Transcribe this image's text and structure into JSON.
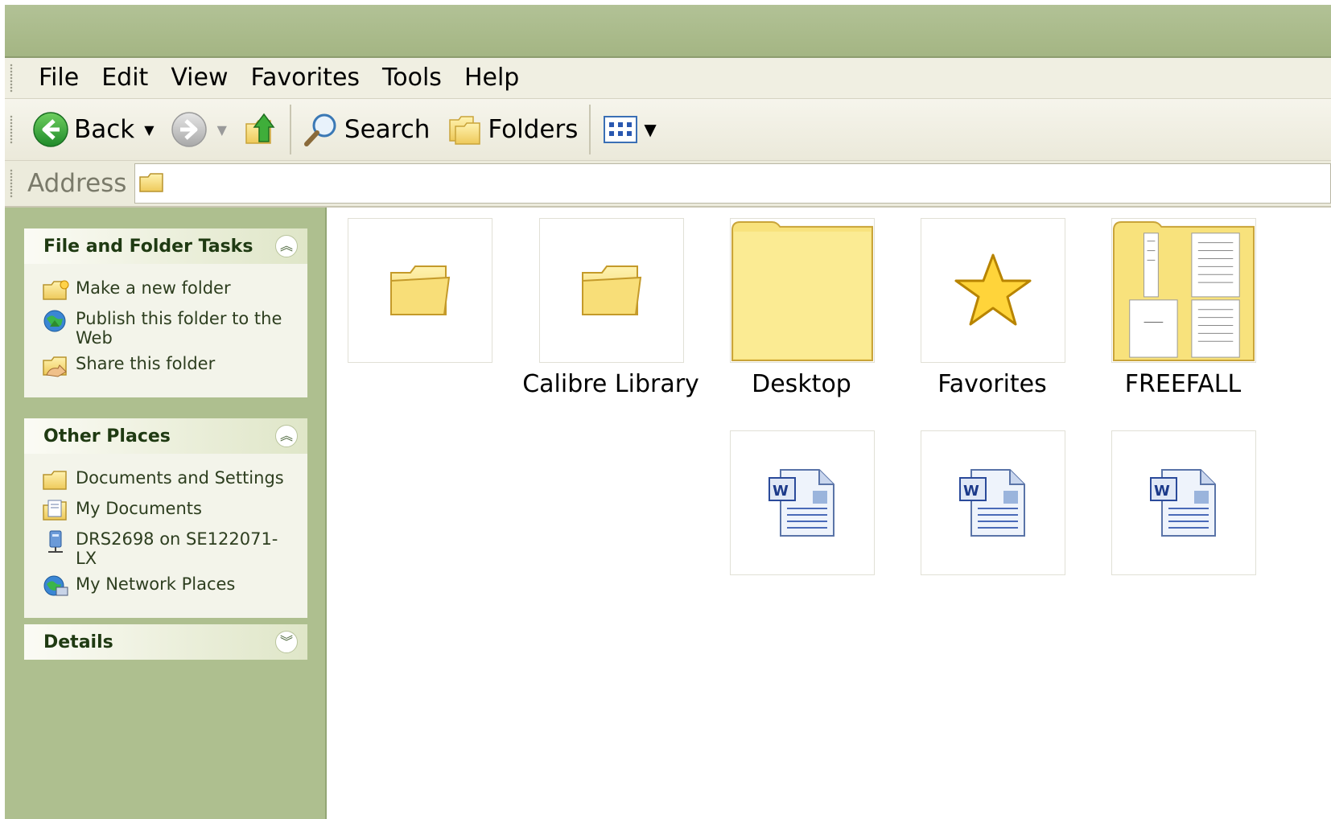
{
  "menubar": {
    "items": [
      "File",
      "Edit",
      "View",
      "Favorites",
      "Tools",
      "Help"
    ]
  },
  "toolbar": {
    "back_label": "Back",
    "search_label": "Search",
    "folders_label": "Folders"
  },
  "addressbar": {
    "label": "Address",
    "value": ""
  },
  "tasks_panel": {
    "title": "File and Folder Tasks",
    "items": [
      {
        "label": "Make a new folder",
        "icon": "new-folder-icon"
      },
      {
        "label": "Publish this folder to the Web",
        "icon": "publish-web-icon"
      },
      {
        "label": "Share this folder",
        "icon": "share-folder-icon"
      }
    ]
  },
  "places_panel": {
    "title": "Other Places",
    "items": [
      {
        "label": "Documents and Settings",
        "icon": "folder-icon"
      },
      {
        "label": "My Documents",
        "icon": "my-documents-icon"
      },
      {
        "label": "DRS2698 on SE122071-LX",
        "icon": "network-drive-icon"
      },
      {
        "label": "My Network Places",
        "icon": "network-places-icon"
      }
    ]
  },
  "details_panel": {
    "title": "Details"
  },
  "files": [
    {
      "label": "",
      "icon": "folder-icon"
    },
    {
      "label": "Calibre Library",
      "icon": "folder-icon"
    },
    {
      "label": "Desktop",
      "icon": "large-folder-icon"
    },
    {
      "label": "Favorites",
      "icon": "star-icon"
    },
    {
      "label": "FREEFALL",
      "icon": "folder-preview-icon"
    },
    {
      "label": "",
      "icon": "word-document-icon"
    },
    {
      "label": "",
      "icon": "word-document-icon"
    },
    {
      "label": "",
      "icon": "word-document-icon"
    }
  ],
  "colors": {
    "title_bar": "#a9ba8a",
    "task_pane": "#aebf8f",
    "folder_yellow": "#f6e38a"
  }
}
